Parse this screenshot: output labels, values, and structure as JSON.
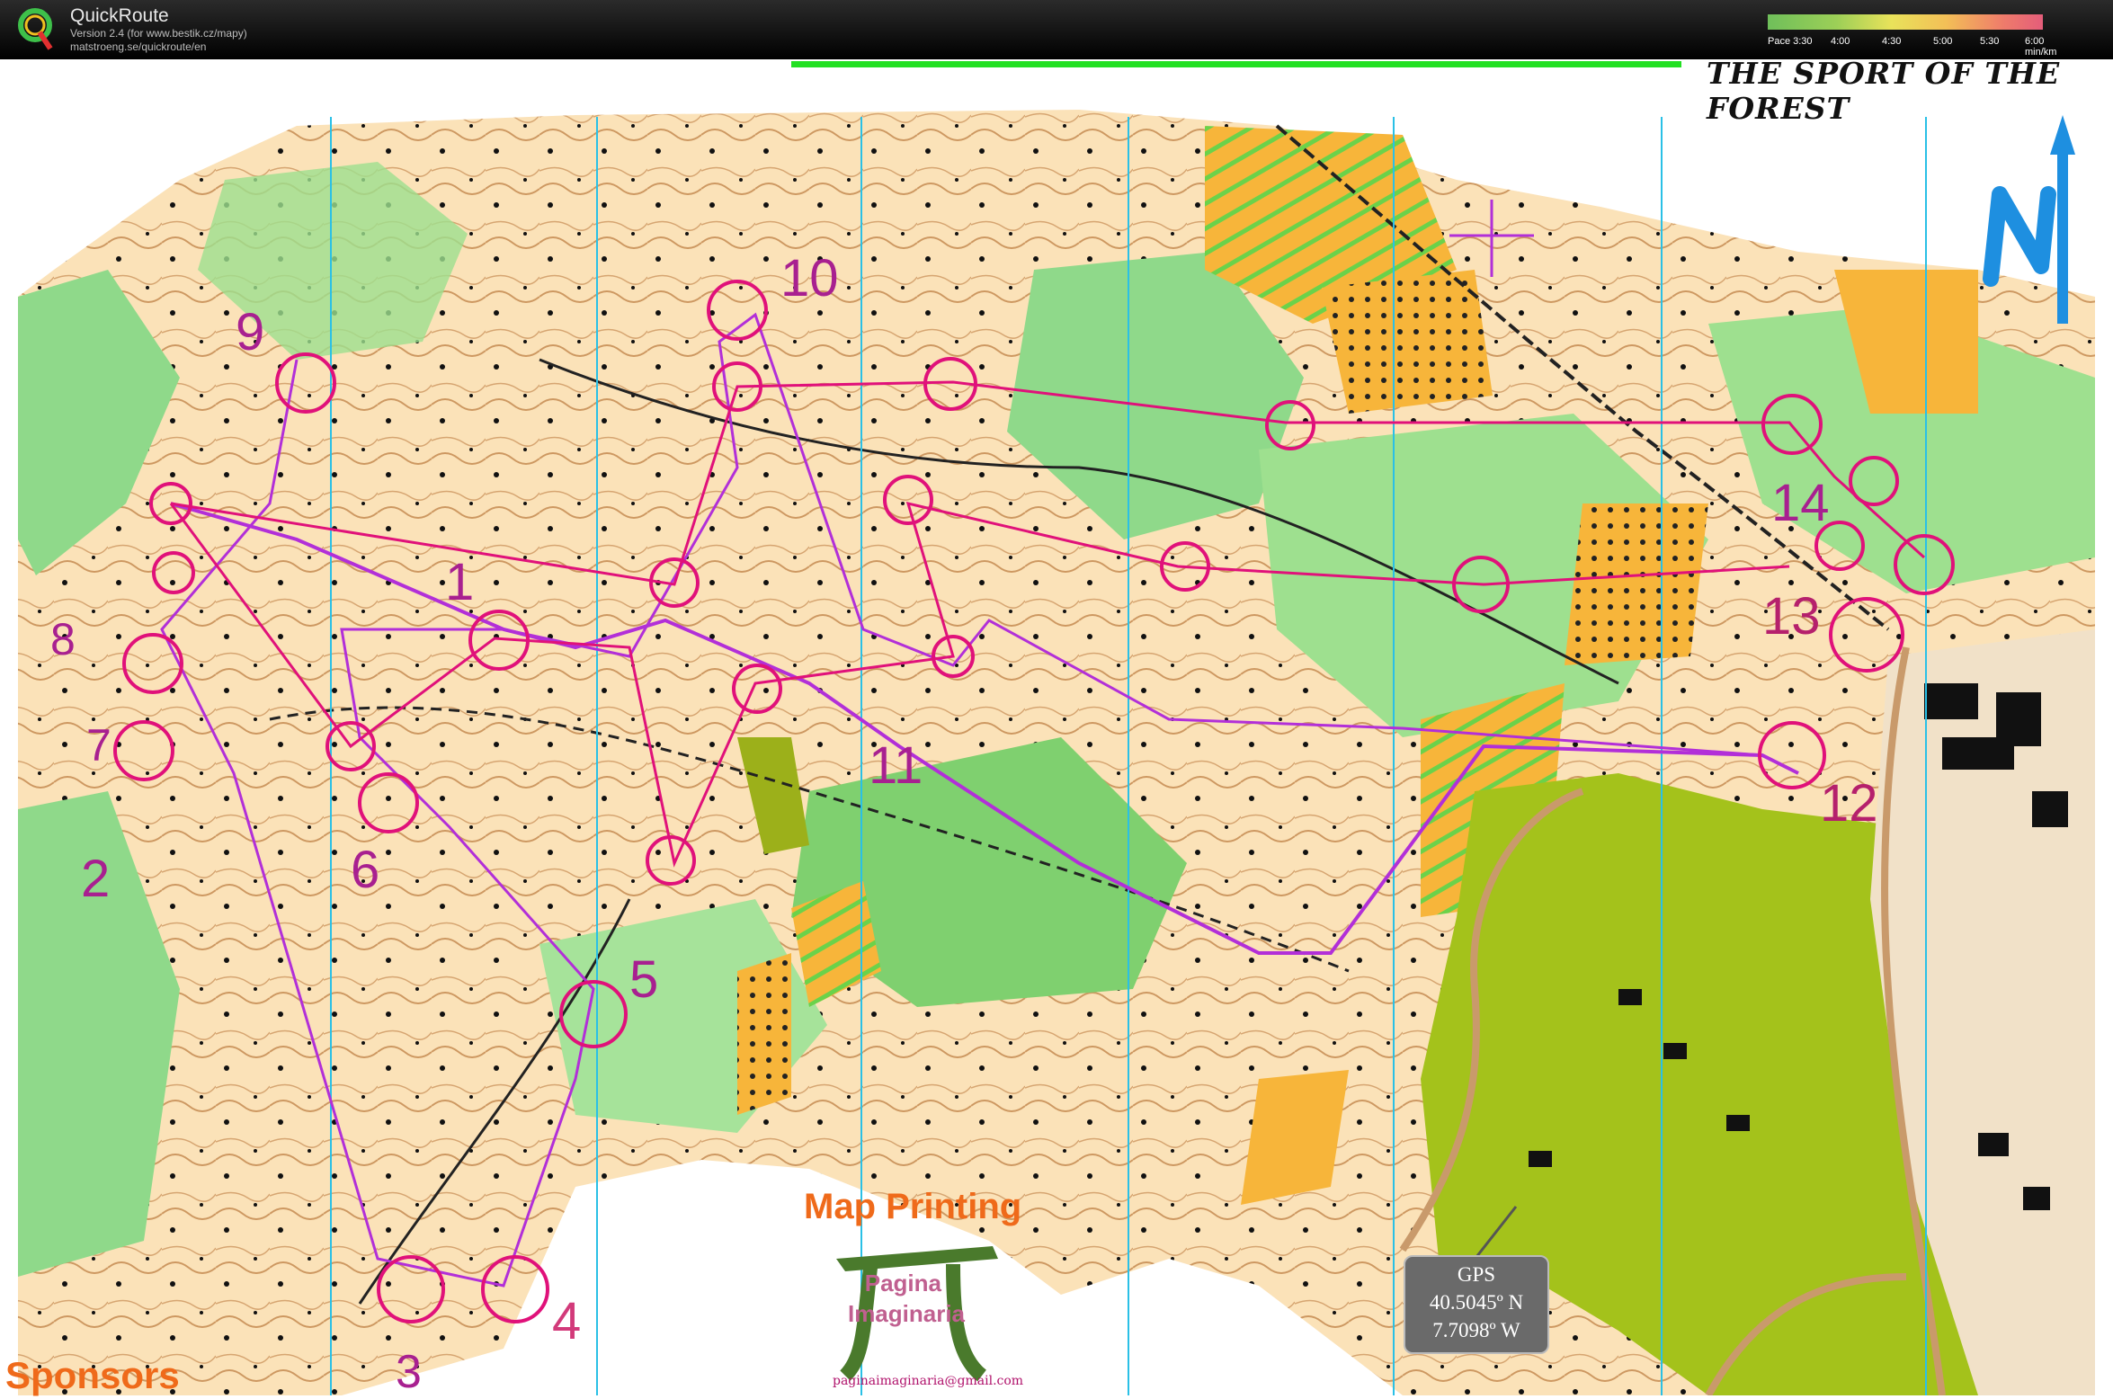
{
  "app": {
    "title": "QuickRoute",
    "version": "Version 2.4  (for www.bestik.cz/mapy)",
    "url": "matstroeng.se/quickroute/en"
  },
  "pace_legend": {
    "ticks": [
      "Pace 3:30",
      "4:00",
      "4:30",
      "5:00",
      "5:30",
      "6:00  min/km"
    ]
  },
  "map": {
    "slogan": "THE SPORT OF THE FOREST",
    "north_label": "N",
    "control_numbers": [
      "1",
      "2",
      "3",
      "4",
      "5",
      "6",
      "7",
      "8",
      "9",
      "10",
      "11",
      "12",
      "13",
      "14"
    ],
    "sponsors_label": "Sponsors",
    "map_printing_label": "Map Printing",
    "sponsor_logo_text": "Pagina Imaginaria",
    "sponsor_email": "paginaimaginaria@gmail.com",
    "gps": {
      "title": "GPS",
      "lat": "40.5045º N",
      "lon": "7.7098º W"
    }
  },
  "colors": {
    "course": "#e0117a",
    "route": "#b22fd8",
    "forest_green": "#8fd98a",
    "open_land": "#f7c46a",
    "olive": "#a4c21b",
    "north_arrow": "#1e8fe0",
    "text_orange": "#ef6a1a"
  }
}
